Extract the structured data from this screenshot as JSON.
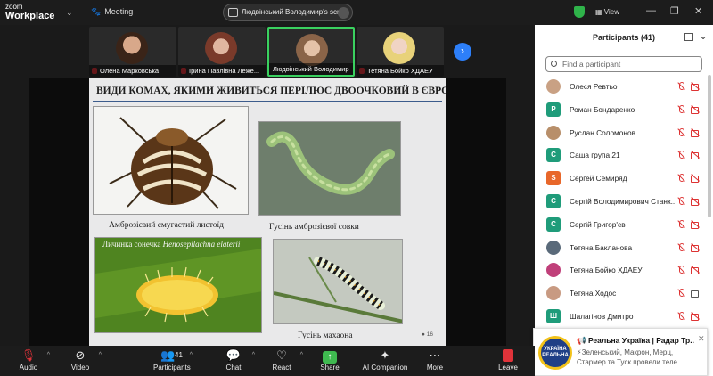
{
  "titlebar": {
    "brand_line1": "zoom",
    "brand_line2": "Workplace",
    "meeting_label": "Meeting",
    "share_label": "Людвінський Володимир's scree",
    "view_label": "View"
  },
  "gallery": [
    {
      "name": "Олена Марковська",
      "face_color": "#6b4a3a"
    },
    {
      "name": "Ірина Павлівна Леже...",
      "face_color": "#8a5a4a"
    },
    {
      "name": "Людвінський Володимир",
      "face_color": "#a88468"
    },
    {
      "name": "Тетяна Бойко ХДАЕУ",
      "face_color": "#d9b49a"
    }
  ],
  "slide": {
    "title": "ВИДИ КОМАХ, ЯКИМИ ЖИВИТЬСЯ ПЕРІЛЮС ДВООЧКОВИЙ В ЄВРОПІ",
    "captions": {
      "leaf_beetle": "Амброзієвий смугастий листоїд",
      "armyworm": "Гусінь амброзієвої совки",
      "ladybird_prefix": "Личинка сонечка",
      "ladybird_species": "Henosepilachna elaterii",
      "swallowtail": "Гусінь махаона"
    },
    "page_number": "16"
  },
  "participants": {
    "title": "Participants (41)",
    "search_placeholder": "Find a participant",
    "items": [
      {
        "name": "Олеся Ревтьо",
        "initial": "",
        "color": "#c9a184",
        "photo": true,
        "cam": "off"
      },
      {
        "name": "Роман Бондаренко",
        "initial": "Р",
        "color": "#1f9c7a",
        "photo": false,
        "cam": "off"
      },
      {
        "name": "Руслан Соломонов",
        "initial": "",
        "color": "#b88f6a",
        "photo": true,
        "cam": "off"
      },
      {
        "name": "Саша група 21",
        "initial": "С",
        "color": "#1f9c7a",
        "photo": false,
        "cam": "off"
      },
      {
        "name": "Сергей Семиряд",
        "initial": "S",
        "color": "#e8672a",
        "photo": false,
        "cam": "off"
      },
      {
        "name": "Сергій Володимирович Станк...",
        "initial": "С",
        "color": "#1f9c7a",
        "photo": false,
        "cam": "off"
      },
      {
        "name": "Сергій Григор'єв",
        "initial": "С",
        "color": "#1f9c7a",
        "photo": false,
        "cam": "off"
      },
      {
        "name": "Тетяна Бакланова",
        "initial": "",
        "color": "#5a6a7a",
        "photo": true,
        "cam": "off"
      },
      {
        "name": "Тетяна Бойко ХДАЕУ",
        "initial": "",
        "color": "#c0407a",
        "photo": true,
        "cam": "off"
      },
      {
        "name": "Тетяна Ходос",
        "initial": "",
        "color": "#c89a82",
        "photo": true,
        "cam": "on"
      },
      {
        "name": "Шалагінов Дмитро",
        "initial": "Ш",
        "color": "#1f9c7a",
        "photo": false,
        "cam": "off"
      }
    ]
  },
  "notification": {
    "logo_line1": "УКРАЇНА",
    "logo_line2": "РЕАЛЬНА",
    "title": "📢 Реальна Україна | Радар Тр...",
    "text": "⚡Зеленський, Макрон, Мерц, Стармер та Туск провели теле..."
  },
  "toolbar": {
    "audio": "Audio",
    "video": "Video",
    "participants": "Participants",
    "participants_count": "41",
    "chat": "Chat",
    "react": "React",
    "share": "Share",
    "ai": "AI Companion",
    "more": "More",
    "leave": "Leave"
  }
}
